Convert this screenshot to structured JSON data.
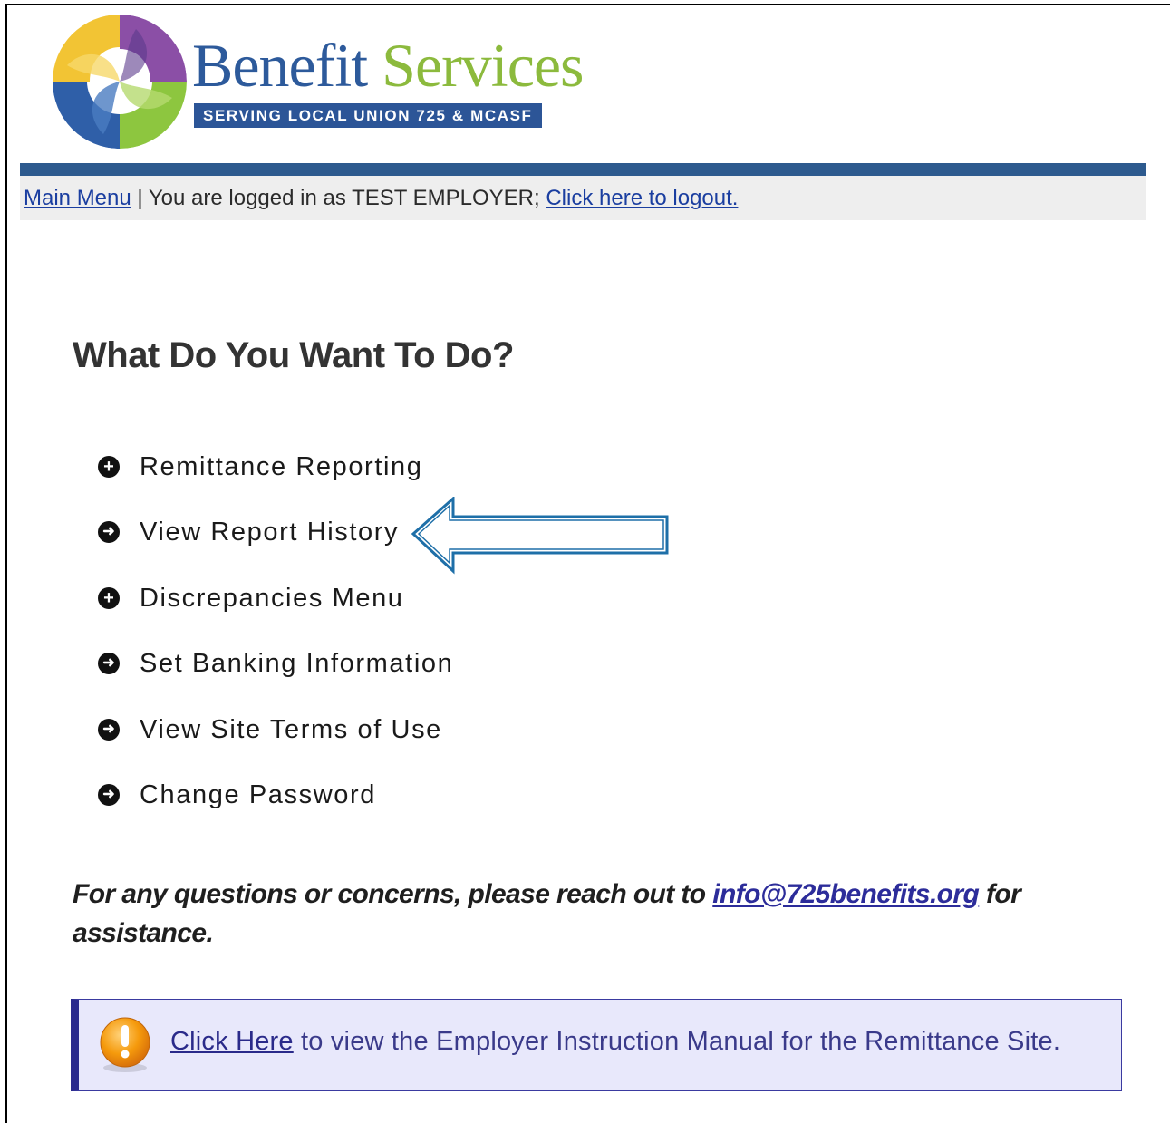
{
  "brand": {
    "word1": "Benefit",
    "word2": "Services",
    "tagline": "SERVING LOCAL UNION 725 & MCASF",
    "colors": {
      "blue": "#2d5a9b",
      "green": "#8cba3d",
      "purple": "#7b4fa0",
      "yellow": "#f2c434"
    }
  },
  "nav": {
    "main_menu": "Main Menu",
    "separator": " | ",
    "logged_in_text": "You are logged in as TEST EMPLOYER; ",
    "logout": "Click here to logout."
  },
  "main": {
    "heading": "What Do You Want To Do?",
    "menu_items": [
      {
        "label": "Remittance Reporting",
        "icon": "plus-circle-icon"
      },
      {
        "label": "View Report History",
        "icon": "arrow-right-circle-icon"
      },
      {
        "label": "Discrepancies Menu",
        "icon": "plus-circle-icon"
      },
      {
        "label": "Set Banking Information",
        "icon": "arrow-right-circle-icon"
      },
      {
        "label": "View Site Terms of Use",
        "icon": "arrow-right-circle-icon"
      },
      {
        "label": "Change Password",
        "icon": "arrow-right-circle-icon"
      }
    ],
    "help": {
      "text_before": "For any questions or concerns, please reach out to ",
      "email": "info@725benefits.org",
      "text_after": " for assistance."
    },
    "notice": {
      "icon": "exclamation-icon",
      "link": "Click Here",
      "text": " to view the Employer Instruction Manual for the Remittance Site."
    }
  },
  "annotation": {
    "icon": "left-arrow-callout-icon",
    "color": "#1e6fa8"
  }
}
